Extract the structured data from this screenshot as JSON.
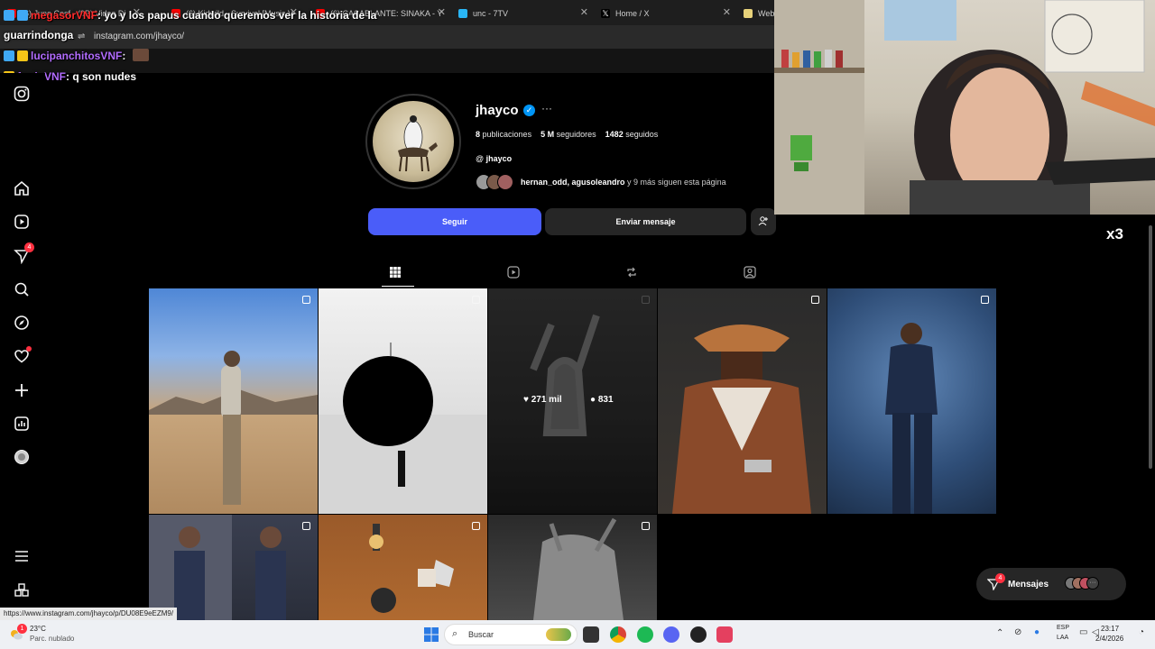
{
  "browser": {
    "tabs": [
      {
        "label": "(6) Juno Cosf - (9B) Video Di",
        "color": "#ff0000"
      },
      {
        "label": "(6) Kidwild - Survival [Music V",
        "color": "#ff0000"
      },
      {
        "label": "(6) CASABLANTE: SINAKA - Y",
        "color": "#ff0000"
      },
      {
        "label": "unc - 7TV",
        "color": "#29b6f6"
      },
      {
        "label": "Home / X",
        "color": "#000000"
      },
      {
        "label": "Webc",
        "color": "#e7d27a"
      }
    ],
    "url": "instagram.com/jhayco/",
    "status_url": "https://www.instagram.com/jhayco/p/DU08E9eEZM9/"
  },
  "chat": [
    {
      "user": "megasorVNF",
      "message": ": yo y los papus cuando queremos ver la historia de la",
      "user_color": "#ff2b2b"
    },
    {
      "user": "guarrindonga",
      "message": "",
      "user_color": "#ffffff"
    },
    {
      "user": "lucipanchitosVNF",
      "message": ":",
      "user_color": "#b26cff"
    },
    {
      "user": "fredoVNF",
      "message": ": q son nudes",
      "user_color": "#b26cff"
    }
  ],
  "sidebar": {
    "items": [
      {
        "name": "instagram-logo-icon"
      },
      {
        "name": "home-icon"
      },
      {
        "name": "reels-icon"
      },
      {
        "name": "messages-icon",
        "badge": "4"
      },
      {
        "name": "search-icon"
      },
      {
        "name": "explore-icon"
      },
      {
        "name": "notifications-icon"
      },
      {
        "name": "create-icon"
      },
      {
        "name": "dashboard-icon"
      },
      {
        "name": "profile-icon"
      },
      {
        "name": "menu-icon"
      },
      {
        "name": "also-from-meta-icon"
      }
    ]
  },
  "profile": {
    "username": "jhayco",
    "verified_glyph": "✓",
    "more_glyph": "···",
    "posts_count": "8",
    "posts_label": "publicaciones",
    "followers_count": "5 M",
    "followers_label": "seguidores",
    "following_count": "1482",
    "following_label": "seguidos",
    "threads_handle": "jhayco",
    "followed_by_names": "hernan_odd, agusoleandro",
    "followed_by_rest": "y 9 más siguen esta página",
    "follow_label": "Seguir",
    "message_label": "Enviar mensaje"
  },
  "profile_tabs": [
    {
      "name": "posts",
      "icon": "grid-icon",
      "active": true
    },
    {
      "name": "reels",
      "icon": "reels-icon",
      "active": false
    },
    {
      "name": "reposts",
      "icon": "repost-icon",
      "active": false
    },
    {
      "name": "tagged",
      "icon": "tagged-icon",
      "active": false
    }
  ],
  "hover_stats": {
    "likes": "271 mil",
    "comments": "831"
  },
  "messages_pill": {
    "label": "Mensajes",
    "badge": "4"
  },
  "overlay": {
    "multiplier": "x3"
  },
  "taskbar": {
    "weather_temp": "23°C",
    "weather_desc": "Parc. nublado",
    "search_label": "Buscar",
    "lang_top": "ESP",
    "lang_bottom": "LAA",
    "time": "23:17",
    "date": "2/4/2026",
    "weather_badge": "1"
  }
}
